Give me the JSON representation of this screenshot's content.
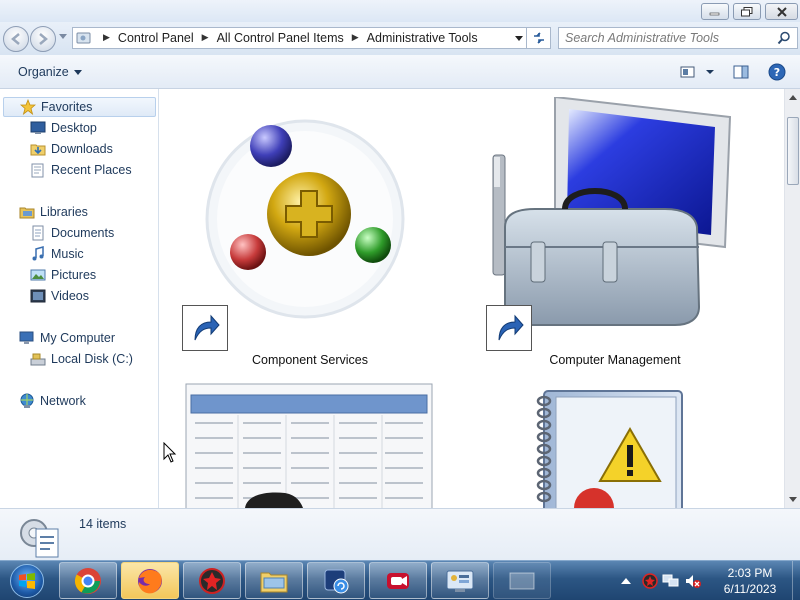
{
  "window": {
    "breadcrumbs": [
      "Control Panel",
      "All Control Panel Items",
      "Administrative Tools"
    ]
  },
  "search": {
    "placeholder": "Search Administrative Tools"
  },
  "toolbar": {
    "organize_label": "Organize"
  },
  "navpane": {
    "favorites": {
      "label": "Favorites",
      "items": [
        "Desktop",
        "Downloads",
        "Recent Places"
      ]
    },
    "libraries": {
      "label": "Libraries",
      "items": [
        "Documents",
        "Music",
        "Pictures",
        "Videos"
      ]
    },
    "computer": {
      "label": "My Computer",
      "items": [
        "Local Disk (C:)"
      ]
    },
    "network": {
      "label": "Network"
    }
  },
  "content": {
    "tiles": [
      {
        "label": "Component Services",
        "icon": "component-services-icon"
      },
      {
        "label": "Computer Management",
        "icon": "computer-management-icon"
      },
      {
        "label": "",
        "icon": "data-sources-icon"
      },
      {
        "label": "",
        "icon": "event-viewer-icon"
      }
    ]
  },
  "details": {
    "count": "14 items"
  },
  "taskbar": {
    "apps": [
      "chrome-icon",
      "firefox-icon",
      "app-icon",
      "windows-explorer-icon",
      "remote-app-icon",
      "recorder-icon",
      "control-panel-icon",
      "window-icon"
    ],
    "clock": {
      "time": "2:03 PM",
      "date": "6/11/2023"
    }
  },
  "colors": {
    "accent": "#1e395b",
    "taskbar": "#2c5684",
    "selection": "#dfeaf7"
  }
}
